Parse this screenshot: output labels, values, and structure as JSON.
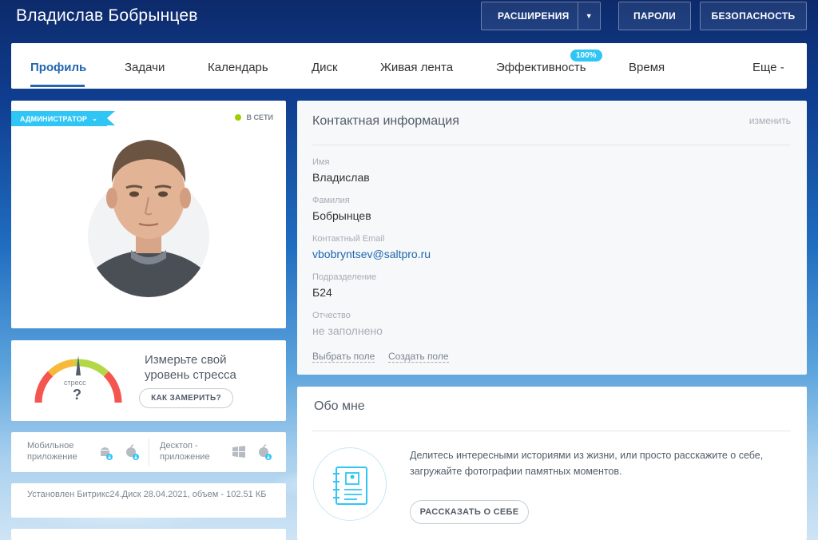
{
  "header": {
    "user_name": "Владислав Бобрынцев",
    "buttons": {
      "extensions": "РАСШИРЕНИЯ",
      "passwords": "ПАРОЛИ",
      "security": "БЕЗОПАСНОСТЬ"
    }
  },
  "nav": {
    "tabs": [
      {
        "label": "Профиль",
        "active": true
      },
      {
        "label": "Задачи"
      },
      {
        "label": "Календарь"
      },
      {
        "label": "Диск"
      },
      {
        "label": "Живая лента"
      },
      {
        "label": "Эффективность",
        "badge": "100%"
      },
      {
        "label": "Время"
      },
      {
        "label": "Еще -"
      }
    ]
  },
  "profile": {
    "role_tag": "АДМИНИСТРАТОР",
    "status": "В СЕТИ",
    "status_color": "#9dcf00"
  },
  "stress": {
    "gauge_label": "стресс",
    "gauge_value": "?",
    "prompt": "Измерьте свой уровень стресса",
    "button": "КАК ЗАМЕРИТЬ?"
  },
  "apps": {
    "mobile_label": "Мобильное приложение",
    "desktop_label": "Десктоп - приложение",
    "mobile_icons": [
      "android-icon",
      "apple-icon"
    ],
    "desktop_icons": [
      "windows-icon",
      "apple-icon"
    ]
  },
  "install_info": "Установлен Битрикс24.Диск 28.04.2021, объем - 102.51 КБ",
  "contact": {
    "title": "Контактная информация",
    "edit_link": "изменить",
    "fields": [
      {
        "label": "Имя",
        "value": "Владислав"
      },
      {
        "label": "Фамилия",
        "value": "Бобрынцев"
      },
      {
        "label": "Контактный Email",
        "value": "vbobryntsev@saltpro.ru"
      },
      {
        "label": "Подразделение",
        "value": "Б24"
      },
      {
        "label": "Отчество",
        "value": "не заполнено"
      }
    ],
    "actions": {
      "choose_field": "Выбрать поле",
      "create_field": "Создать поле"
    }
  },
  "about": {
    "title": "Обо мне",
    "text": "Делитесь интересными историями из жизни, или просто расскажите о себе, загружайте фотографии памятных моментов.",
    "button": "РАССКАЗАТЬ О СЕБЕ"
  },
  "colors": {
    "accent": "#2067b0",
    "badge": "#2fc6f6"
  }
}
